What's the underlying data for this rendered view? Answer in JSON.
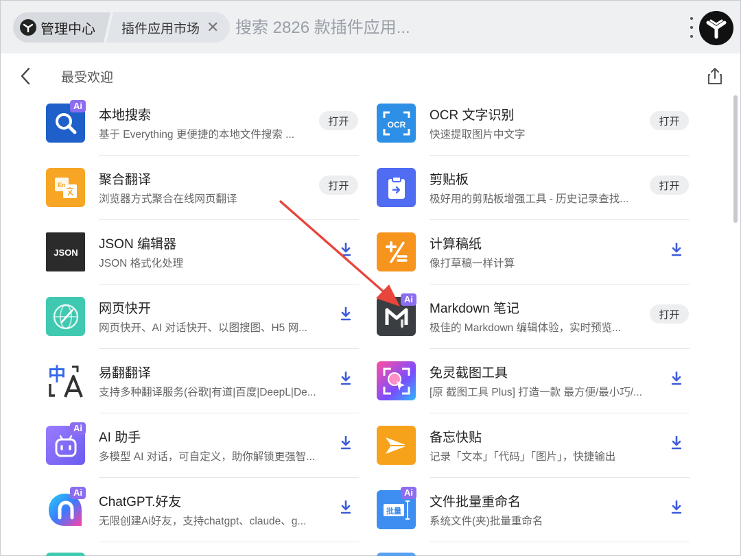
{
  "topbar": {
    "home_label": "管理中心",
    "tab_label": "插件应用市场",
    "search_placeholder": "搜索 2826 款插件应用..."
  },
  "header": {
    "title": "最受欢迎"
  },
  "buttons": {
    "open_label": "打开"
  },
  "colors": {
    "ai_badge": "#8c6df0",
    "download": "#3d5bd9",
    "annotation_arrow": "#e8453c"
  },
  "plugins": [
    {
      "name": "本地搜索",
      "desc": "基于 Everything 更便捷的本地文件搜索 ...",
      "ai": true,
      "action": "open",
      "icon": "search-icon"
    },
    {
      "name": "OCR 文字识别",
      "desc": "快速提取图片中文字",
      "ai": false,
      "action": "open",
      "icon": "ocr-icon",
      "icon_text": "OCR"
    },
    {
      "name": "聚合翻译",
      "desc": "浏览器方式聚合在线网页翻译",
      "ai": false,
      "action": "open",
      "icon": "translate-icon",
      "icon_text": "En"
    },
    {
      "name": "剪贴板",
      "desc": "极好用的剪贴板增强工具 - 历史记录查找...",
      "ai": false,
      "action": "open",
      "icon": "clipboard-icon"
    },
    {
      "name": "JSON 编辑器",
      "desc": "JSON 格式化处理",
      "ai": false,
      "action": "download",
      "icon": "json-icon",
      "icon_text": "JSON"
    },
    {
      "name": "计算稿纸",
      "desc": "像打草稿一样计算",
      "ai": false,
      "action": "download",
      "icon": "calculator-icon"
    },
    {
      "name": "网页快开",
      "desc": "网页快开、AI 对话快开、以图搜图、H5 网...",
      "ai": false,
      "action": "download",
      "icon": "rocket-globe-icon"
    },
    {
      "name": "Markdown 笔记",
      "desc": "极佳的 Markdown 编辑体验，实时预览...",
      "ai": true,
      "action": "open",
      "icon": "markdown-icon"
    },
    {
      "name": "易翻翻译",
      "desc": "支持多种翻译服务(谷歌|有道|百度|DeepL|De...",
      "ai": false,
      "action": "download",
      "icon": "translate-zh-a-icon",
      "icon_text": "中"
    },
    {
      "name": "免灵截图工具",
      "desc": "[原 截图工具 Plus] 打造一款 最方便/最小巧/...",
      "ai": false,
      "action": "download",
      "icon": "screenshot-icon"
    },
    {
      "name": "AI 助手",
      "desc": "多模型 AI 对话，可自定义，助你解锁更强智...",
      "ai": true,
      "action": "download",
      "icon": "robot-icon"
    },
    {
      "name": "备忘快贴",
      "desc": "记录「文本」「代码」「图片」，快捷输出",
      "ai": false,
      "action": "download",
      "icon": "paper-plane-icon"
    },
    {
      "name": "ChatGPT.好友",
      "desc": "无限创建Ai好友，支持chatgpt、claude、g...",
      "ai": true,
      "action": "download",
      "icon": "chat-friend-icon"
    },
    {
      "name": "文件批量重命名",
      "desc": "系统文件(夹)批量重命名",
      "ai": true,
      "action": "download",
      "icon": "batch-rename-icon",
      "icon_text": "批量"
    }
  ]
}
